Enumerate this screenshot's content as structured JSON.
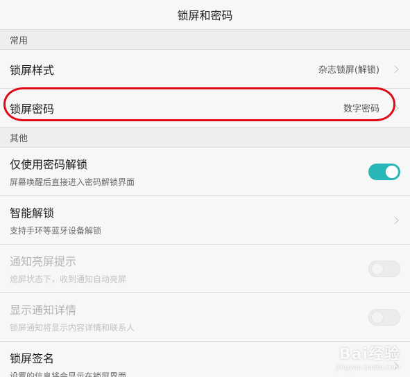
{
  "header": {
    "title": "锁屏和密码"
  },
  "sections": {
    "common": "常用",
    "other": "其他"
  },
  "rows": {
    "lock_style": {
      "label": "锁屏样式",
      "value": "杂志锁屏(解锁)"
    },
    "lock_password": {
      "label": "锁屏密码",
      "value": "数字密码"
    },
    "password_only": {
      "label": "仅使用密码解锁",
      "sub": "屏幕唤醒后直接进入密码解锁界面",
      "toggle": "on"
    },
    "smart_unlock": {
      "label": "智能解锁",
      "sub": "支持手环等蓝牙设备解锁"
    },
    "notify_wake": {
      "label": "通知亮屏提示",
      "sub": "熄屏状态下，收到通知自动亮屏",
      "toggle": "off"
    },
    "notify_detail": {
      "label": "显示通知详情",
      "sub": "锁屏通知将显示内容详情和联系人",
      "toggle": "off"
    },
    "lock_signature": {
      "label": "锁屏签名",
      "sub": "设置的信息将会显示在锁屏界面"
    }
  },
  "colors": {
    "accent": "#29b6b8",
    "highlight": "#e00a17"
  },
  "watermark": {
    "brand": "Bai经验",
    "domain": "jingyan.baidu.com"
  }
}
